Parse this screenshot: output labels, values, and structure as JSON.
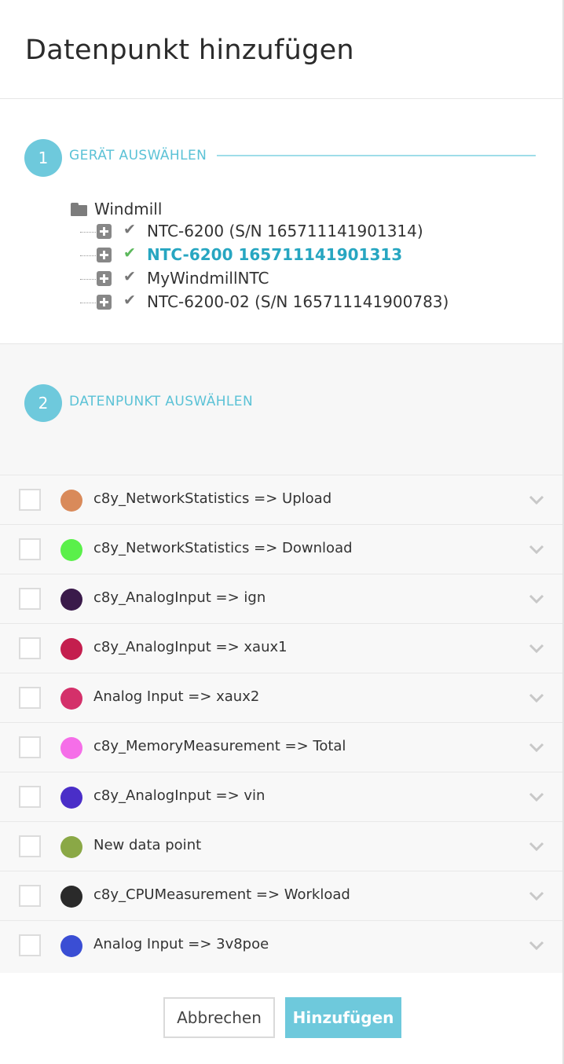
{
  "modal": {
    "title": "Datenpunkt hinzufügen"
  },
  "step1": {
    "number": "1",
    "label": "GERÄT AUSWÄHLEN",
    "tree": {
      "root": "Windmill",
      "nodes": [
        {
          "label": "NTC-6200 (S/N 165711141901314)",
          "selected": false
        },
        {
          "label": "NTC-6200 165711141901313",
          "selected": true
        },
        {
          "label": "MyWindmillNTC",
          "selected": false
        },
        {
          "label": "NTC-6200-02 (S/N 165711141900783)",
          "selected": false
        }
      ]
    }
  },
  "step2": {
    "number": "2",
    "label": "DATENPUNKT AUSWÄHLEN",
    "datapoints": [
      {
        "label": "c8y_NetworkStatistics => Upload",
        "color": "#d98a5a"
      },
      {
        "label": "c8y_NetworkStatistics => Download",
        "color": "#5af04a"
      },
      {
        "label": "c8y_AnalogInput => ign",
        "color": "#3a1a4a"
      },
      {
        "label": "c8y_AnalogInput => xaux1",
        "color": "#c41e4e"
      },
      {
        "label": "Analog Input => xaux2",
        "color": "#d4306a"
      },
      {
        "label": "c8y_MemoryMeasurement => Total",
        "color": "#f56ee8"
      },
      {
        "label": "c8y_AnalogInput => vin",
        "color": "#4a2ec8"
      },
      {
        "label": "New data point",
        "color": "#8aa846"
      },
      {
        "label": "c8y_CPUMeasurement => Workload",
        "color": "#2a2a2a"
      },
      {
        "label": "Analog Input => 3v8poe",
        "color": "#3a4ed4"
      }
    ]
  },
  "footer": {
    "cancel_label": "Abbrechen",
    "add_label": "Hinzufügen"
  },
  "colors": {
    "accent": "#6ec9dc",
    "active_text": "#27a6c1",
    "check_green": "#5cb85c"
  }
}
